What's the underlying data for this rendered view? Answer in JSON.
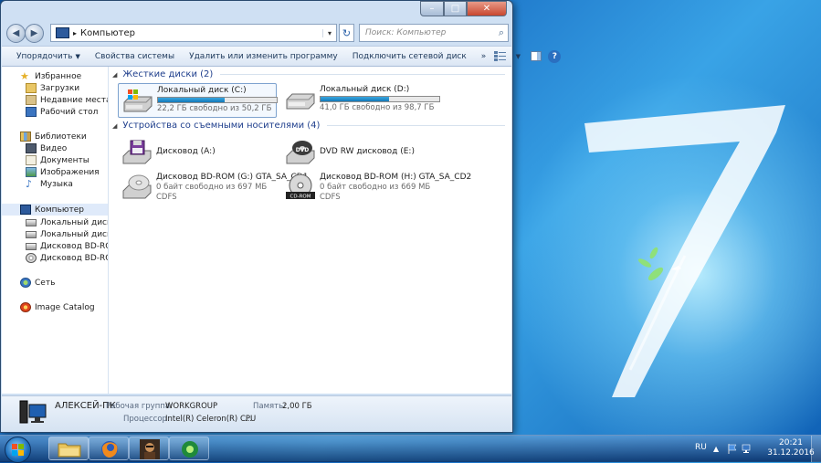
{
  "window": {
    "caption": {
      "minimize": "–",
      "maximize": "□",
      "close": "✕"
    },
    "back": "◀",
    "forward": "▶",
    "address": "Компьютер",
    "address_sep": "▸",
    "dd_arrow": "▾",
    "refresh": "↻",
    "search_placeholder": "Поиск: Компьютер",
    "search_icon": "search-icon"
  },
  "toolbar": {
    "organize": "Упорядочить",
    "organize_arrow": "▼",
    "system_properties": "Свойства системы",
    "uninstall": "Удалить или изменить программу",
    "map_drive": "Подключить сетевой диск",
    "more": "»",
    "view_arrow": "▼",
    "help": "?"
  },
  "nav": {
    "favorites": "Избранное",
    "downloads": "Загрузки",
    "recent": "Недавние места",
    "desktop": "Рабочий стол",
    "libraries": "Библиотеки",
    "video": "Видео",
    "documents": "Документы",
    "images": "Изображения",
    "music": "Музыка",
    "computer": "Компьютер",
    "drive_c": "Локальный диск (C:)",
    "drive_d": "Локальный диск (D:)",
    "bd_g": "Дисковод BD-ROM (",
    "bd_h": "Дисковод BD-ROM (",
    "network": "Сеть",
    "image_catalog": "Image Catalog"
  },
  "content": {
    "hdd_group": "Жесткие диски (2)",
    "removable_group": "Устройства со съемными носителями (4)",
    "drives": [
      {
        "name": "Локальный диск (C:)",
        "free": "22,2 ГБ свободно из 50,2 ГБ",
        "used_fraction": 0.56
      },
      {
        "name": "Локальный диск (D:)",
        "free": "41,0 ГБ свободно из 98,7 ГБ",
        "used_fraction": 0.58
      }
    ],
    "removable": [
      {
        "name": "Дисковод (A:)"
      },
      {
        "name": "DVD RW дисковод (E:)",
        "label": "DVD"
      },
      {
        "name": "Дисковод BD-ROM (G:) GTA_SA_CD1",
        "free": "0 байт свободно из 697 МБ",
        "fs": "CDFS"
      },
      {
        "name": "Дисковод BD-ROM (H:) GTA_SA_CD2",
        "free": "0 байт свободно из 669 МБ",
        "fs": "CDFS",
        "label": "CD-ROM"
      }
    ]
  },
  "details": {
    "pc_name": "АЛЕКСЕЙ-ПК",
    "workgroup_label": "Рабочая группа:",
    "workgroup": "WORKGROUP",
    "memory_label": "Память:",
    "memory": "2,00 ГБ",
    "cpu_label": "Процессор:",
    "cpu": "Intel(R) Celeron(R) CPU",
    "cpu_more": "..."
  },
  "taskbar": {
    "lang": "RU",
    "time": "20:21",
    "date": "31.12.2016"
  }
}
